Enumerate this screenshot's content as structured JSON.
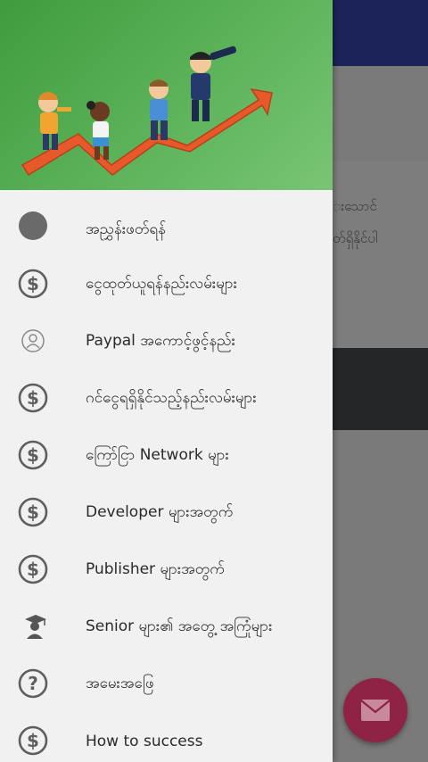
{
  "background": {
    "text_line_1": "းသောင်",
    "text_line_2": "တ်ရှိနိုင်ပါ"
  },
  "drawer": {
    "menu": [
      {
        "label": "အညွှန်းဖတ်ရန်",
        "icon": "circle-icon"
      },
      {
        "label": "ငွေထုတ်ယူရန်နည်းလမ်းများ",
        "icon": "dollar-icon"
      },
      {
        "label": "Paypal အကောင့်ဖွင့်နည်း",
        "icon": "user-icon"
      },
      {
        "label": "ဂင်ငွေရရှိနိုင်သည့်နည်းလမ်းများ",
        "icon": "dollar-icon"
      },
      {
        "label": "ကြော်ငြာ Network များ",
        "icon": "dollar-icon"
      },
      {
        "label": "Developer များအတွက်",
        "icon": "dollar-icon"
      },
      {
        "label": "Publisher များအတွက်",
        "icon": "dollar-icon"
      },
      {
        "label": "Senior များ၏ အတွေ့ အကြုံများ",
        "icon": "graduate-icon"
      },
      {
        "label": "အမေးအဖြေ",
        "icon": "question-icon"
      },
      {
        "label": "How to success",
        "icon": "dollar-icon"
      }
    ]
  },
  "colors": {
    "toolbar": "#1c2358",
    "header_green": "#5db35a",
    "fab": "#8e2346"
  }
}
